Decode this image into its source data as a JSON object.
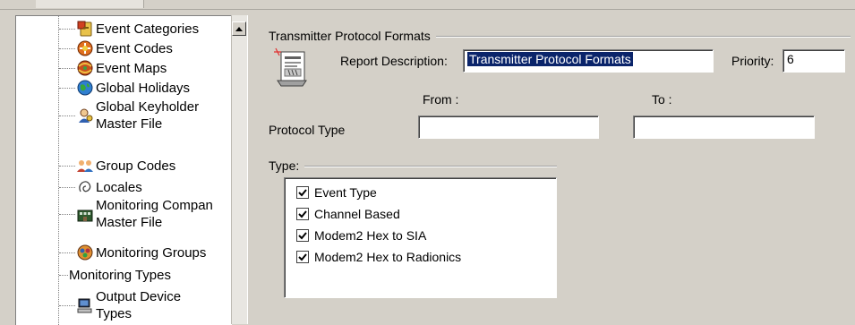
{
  "tree": {
    "items": [
      {
        "label": "Event Categories",
        "icon": "event-categories-icon"
      },
      {
        "label": "Event Codes",
        "icon": "event-codes-icon"
      },
      {
        "label": "Event Maps",
        "icon": "event-maps-icon"
      },
      {
        "label": "Global Holidays",
        "icon": "globe-icon"
      },
      {
        "label_line1": "Global Keyholder",
        "label_line2": "Master File",
        "icon": "keyholder-icon"
      },
      {
        "label": "Group Codes",
        "icon": "group-icon"
      },
      {
        "label": "Locales",
        "icon": "locale-icon"
      },
      {
        "label_line1": "Monitoring Compan",
        "label_line2": "Master File",
        "icon": "building-icon"
      },
      {
        "label": "Monitoring Groups",
        "icon": "monitoring-groups-icon"
      },
      {
        "label": "Monitoring Types",
        "icon": ""
      },
      {
        "label_line1": "Output Device",
        "label_line2": "Types",
        "icon": "computer-icon"
      }
    ]
  },
  "form": {
    "group_title": "Transmitter Protocol Formats",
    "report_description_label": "Report Description:",
    "report_description_value": "Transmitter Protocol Formats",
    "priority_label": "Priority:",
    "priority_value": "6",
    "from_label": "From :",
    "to_label": "To :",
    "protocol_type_label": "Protocol Type",
    "from_value": "",
    "to_value": "",
    "type_group_title": "Type:",
    "types": [
      {
        "label": "Event Type",
        "checked": true
      },
      {
        "label": "Channel Based",
        "checked": true
      },
      {
        "label": "Modem2 Hex to SIA",
        "checked": true
      },
      {
        "label": "Modem2 Hex to Radionics",
        "checked": true
      }
    ]
  },
  "colors": {
    "window_bg": "#d4d0c8",
    "selection": "#0a246a"
  }
}
